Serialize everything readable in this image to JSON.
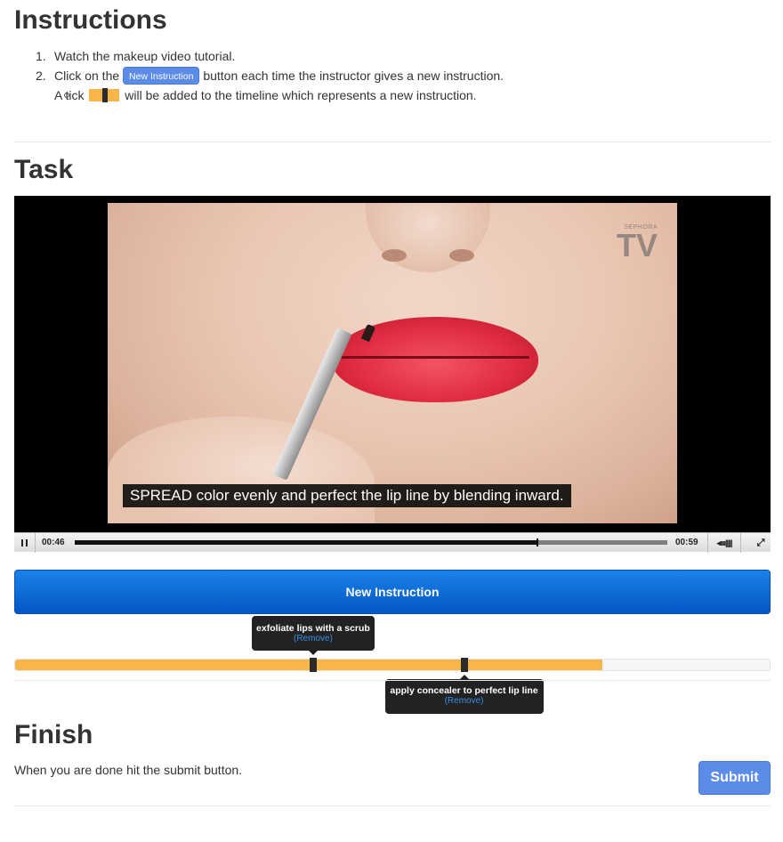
{
  "instructions": {
    "title": "Instructions",
    "steps": [
      {
        "num": "1.",
        "text": "Watch the makeup video tutorial."
      },
      {
        "num": "2.",
        "before": "Click on the",
        "button_label": "New Instruction",
        "after": "button each time the instructor gives a new instruction."
      }
    ],
    "sub_before": "A tick",
    "sub_after": "will be added to the timeline which represents a new instruction."
  },
  "task": {
    "title": "Task",
    "video": {
      "logo_small": "SEPHORA",
      "logo_big": "TV",
      "caption": "SPREAD color evenly and perfect the lip line by blending inward.",
      "current_time": "00:46",
      "duration": "00:59",
      "progress": 0.78,
      "volume_glyph": "◂ıııı|||||",
      "fullscreen_glyph": "⤢"
    },
    "new_instruction_label": "New Instruction",
    "timeline": {
      "fill_fraction": 0.778,
      "ticks": [
        {
          "position": 0.395,
          "label": "exfoliate lips with a scrub",
          "remove": "(Remove)"
        },
        {
          "position": 0.595,
          "label": "apply concealer to perfect lip line",
          "remove": "(Remove)"
        }
      ]
    }
  },
  "finish": {
    "title": "Finish",
    "text": "When you are done hit the submit button.",
    "submit_label": "Submit"
  },
  "colors": {
    "accent_blue": "#1a82e8",
    "timeline_orange": "#f7b54a",
    "submit_blue": "#5b8ce8"
  }
}
